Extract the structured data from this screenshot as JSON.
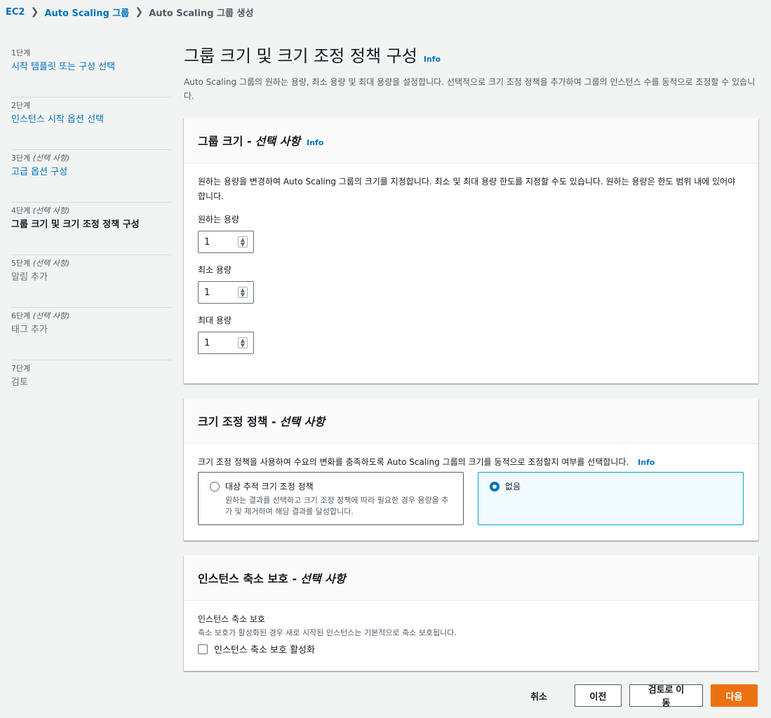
{
  "breadcrumb": [
    {
      "label": "EC2"
    },
    {
      "label": "Auto Scaling 그룹"
    },
    {
      "label": "Auto Scaling 그룹 생성"
    }
  ],
  "steps": [
    {
      "num": "1단계",
      "optional": "",
      "title": "시작 템플릿 또는 구성 선택",
      "state": "link"
    },
    {
      "num": "2단계",
      "optional": "",
      "title": "인스턴스 시작 옵션 선택",
      "state": "link"
    },
    {
      "num": "3단계",
      "optional": "(선택 사항)",
      "title": "고급 옵션 구성",
      "state": "link"
    },
    {
      "num": "4단계",
      "optional": "(선택 사항)",
      "title": "그룹 크기 및 크기 조정 정책 구성",
      "state": "active"
    },
    {
      "num": "5단계",
      "optional": "(선택 사항)",
      "title": "알림 추가",
      "state": "disabled"
    },
    {
      "num": "6단계",
      "optional": "(선택 사항)",
      "title": "태그 추가",
      "state": "disabled"
    },
    {
      "num": "7단계",
      "optional": "",
      "title": "검토",
      "state": "disabled"
    }
  ],
  "page": {
    "title": "그룹 크기 및 크기 조정 정책 구성",
    "info": "Info",
    "description": "Auto Scaling 그룹의 원하는 용량, 최소 용량 및 최대 용량을 설정합니다. 선택적으로 크기 조정 정책을 추가하여 그룹의 인스턴스 수를 동적으로 조정할 수 있습니다."
  },
  "group_size": {
    "title": "그룹 크기 -",
    "title_optional": "선택 사항",
    "info": "Info",
    "description": "원하는 용량을 변경하여 Auto Scaling 그룹의 크기를 지정합니다. 최소 및 최대 용량 한도를 지정할 수도 있습니다. 원하는 용량은 한도 범위 내에 있어야 합니다.",
    "desired_label": "원하는 용량",
    "desired_value": "1",
    "min_label": "최소 용량",
    "min_value": "1",
    "max_label": "최대 용량",
    "max_value": "1"
  },
  "scaling": {
    "title": "크기 조정 정책 -",
    "title_optional": "선택 사항",
    "description": "크기 조정 정책을 사용하여 수요의 변화를 충족하도록 Auto Scaling 그룹의 크기를 동적으로 조정할지 여부를 선택합니다.",
    "info": "Info",
    "option1_label": "대상 추적 크기 조정 정책",
    "option1_desc": "원하는 결과를 선택하고 크기 조정 정책에 따라 필요한 경우 용량을 추가 및 제거하여 해당 결과를 달성합니다.",
    "option2_label": "없음"
  },
  "protection": {
    "title": "인스턴스 축소 보호 -",
    "title_optional": "선택 사항",
    "label": "인스턴스 축소 보호",
    "description": "축소 보호가 활성화된 경우 새로 시작된 인스턴스는 기본적으로 축소 보호됩니다.",
    "checkbox_label": "인스턴스 축소 보호 활성화"
  },
  "actions": {
    "cancel": "취소",
    "previous": "이전",
    "review": "검토로 이동",
    "next": "다음"
  }
}
